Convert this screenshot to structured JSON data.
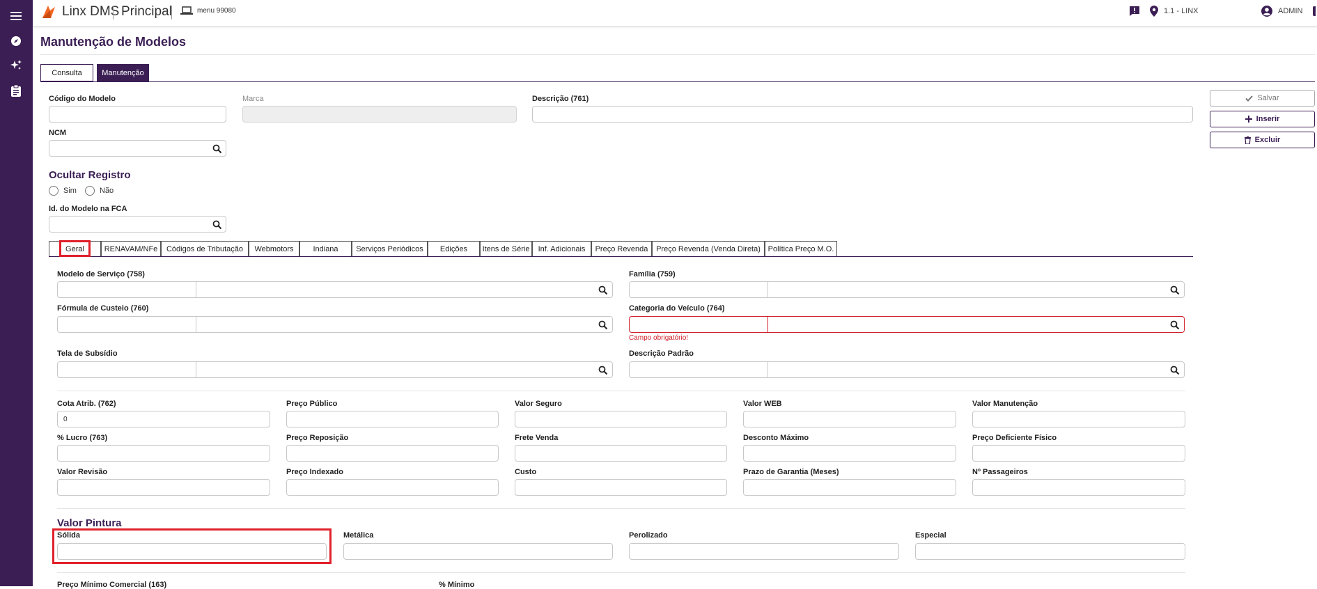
{
  "app": {
    "brand": "Linx DMS",
    "module": "Principal",
    "menu_label": "menu 99080"
  },
  "topbar": {
    "location": "1.1 - LINX",
    "user": "ADMIN"
  },
  "page": {
    "title": "Manutenção de Modelos"
  },
  "main_tabs": [
    {
      "label": "Consulta",
      "active": false
    },
    {
      "label": "Manutenção",
      "active": true
    }
  ],
  "header_fields": {
    "codigo_modelo": {
      "label": "Código do Modelo",
      "value": ""
    },
    "marca": {
      "label": "Marca",
      "value": ""
    },
    "descricao": {
      "label": "Descrição (761)",
      "value": ""
    },
    "ncm": {
      "label": "NCM",
      "value": ""
    },
    "id_fca": {
      "label": "Id. do Modelo na FCA",
      "value": ""
    }
  },
  "ocultar": {
    "title": "Ocultar Registro",
    "options": [
      "Sim",
      "Não"
    ]
  },
  "actions": {
    "save": "Salvar",
    "insert": "Inserir",
    "delete": "Excluir"
  },
  "sub_tabs": [
    "Geral",
    "RENAVAM/NFe",
    "Códigos de Tributação",
    "Webmotors",
    "Indiana",
    "Serviços Periódicos",
    "Edições",
    "Itens de Série",
    "Inf. Adicionais",
    "Preço Revenda",
    "Preço Revenda (Venda Direta)",
    "Política Preço M.O."
  ],
  "geral": {
    "modelo_servico": "Modelo de Serviço (758)",
    "familia": "Família (759)",
    "formula_custeio": "Fórmula de Custeio (760)",
    "categoria_veiculo": "Categoria do Veículo (764)",
    "campo_obrigatorio": "Campo obrigatório!",
    "tela_subsidio": "Tela de Subsídio",
    "descricao_padrao": "Descrição Padrão"
  },
  "price_grid": [
    [
      {
        "label": "Cota Atrib. (762)",
        "value": "0"
      },
      {
        "label": "Preço Público",
        "value": ""
      },
      {
        "label": "Valor Seguro",
        "value": ""
      },
      {
        "label": "Valor WEB",
        "value": ""
      },
      {
        "label": "Valor Manutenção",
        "value": ""
      }
    ],
    [
      {
        "label": "% Lucro (763)",
        "value": ""
      },
      {
        "label": "Preço Reposição",
        "value": ""
      },
      {
        "label": "Frete Venda",
        "value": ""
      },
      {
        "label": "Desconto Máximo",
        "value": ""
      },
      {
        "label": "Preço Deficiente Físico",
        "value": ""
      }
    ],
    [
      {
        "label": "Valor Revisão",
        "value": ""
      },
      {
        "label": "Preço Indexado",
        "value": ""
      },
      {
        "label": "Custo",
        "value": ""
      },
      {
        "label": "Prazo de Garantia (Meses)",
        "value": ""
      },
      {
        "label": "Nº Passageiros",
        "value": ""
      }
    ]
  ],
  "pintura": {
    "title": "Valor Pintura",
    "fields": [
      "Sólida",
      "Metálica",
      "Perolizado",
      "Especial"
    ]
  },
  "bottom": {
    "preco_minimo": "Preço Mínimo Comercial (163)",
    "pct_minimo": "% Mínimo"
  }
}
